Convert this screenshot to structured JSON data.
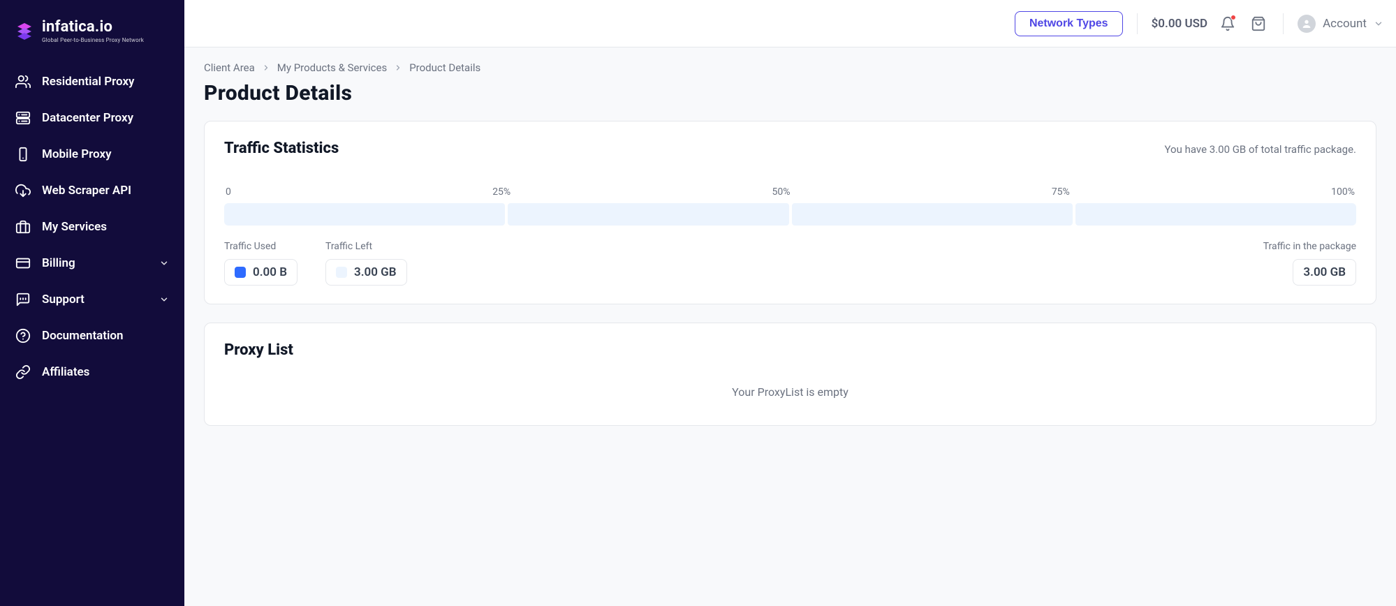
{
  "brand": {
    "name": "infatica.io",
    "subtitle": "Global Peer-to-Business Proxy Network"
  },
  "sidebar": {
    "items": [
      {
        "label": "Residential Proxy",
        "icon": "users-icon",
        "expandable": false
      },
      {
        "label": "Datacenter Proxy",
        "icon": "server-icon",
        "expandable": false
      },
      {
        "label": "Mobile Proxy",
        "icon": "mobile-icon",
        "expandable": false
      },
      {
        "label": "Web Scraper API",
        "icon": "download-cloud-icon",
        "expandable": false
      },
      {
        "label": "My Services",
        "icon": "briefcase-icon",
        "expandable": false
      },
      {
        "label": "Billing",
        "icon": "credit-card-icon",
        "expandable": true
      },
      {
        "label": "Support",
        "icon": "chat-icon",
        "expandable": true
      },
      {
        "label": "Documentation",
        "icon": "help-icon",
        "expandable": false
      },
      {
        "label": "Affiliates",
        "icon": "link-icon",
        "expandable": false
      }
    ]
  },
  "header": {
    "network_types_label": "Network Types",
    "balance": "$0.00 USD",
    "account_label": "Account"
  },
  "breadcrumb": [
    "Client Area",
    "My Products & Services",
    "Product Details"
  ],
  "page_title": "Product Details",
  "traffic_stats": {
    "title": "Traffic Statistics",
    "note": "You have 3.00 GB of total traffic package.",
    "ticks": [
      "0",
      "25%",
      "50%",
      "75%",
      "100%"
    ],
    "used": {
      "label": "Traffic Used",
      "value": "0.00 B"
    },
    "left": {
      "label": "Traffic Left",
      "value": "3.00 GB"
    },
    "package": {
      "label": "Traffic in the package",
      "value": "3.00 GB"
    }
  },
  "proxy_list": {
    "title": "Proxy List",
    "empty_text": "Your ProxyList is empty"
  },
  "chart_data": {
    "type": "bar",
    "title": "Traffic Statistics",
    "categories": [
      "0",
      "25%",
      "50%",
      "75%",
      "100%"
    ],
    "series": [
      {
        "name": "Traffic Used",
        "values": [
          0
        ]
      }
    ],
    "xlabel": "",
    "ylabel": "",
    "ylim": [
      0,
      100
    ],
    "meta": {
      "total": "3.00 GB",
      "used": "0.00 B",
      "left": "3.00 GB",
      "percent_used": 0
    }
  }
}
